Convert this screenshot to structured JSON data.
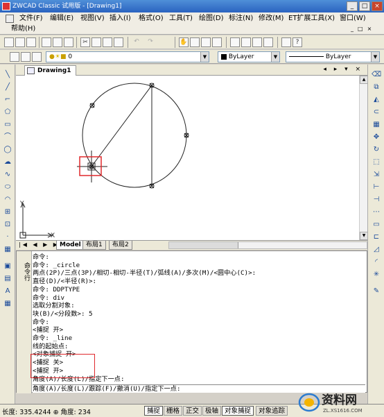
{
  "window": {
    "title": "ZWCAD Classic 试用版 - [Drawing1]",
    "controls": [
      "_",
      "□",
      "×"
    ]
  },
  "menu": {
    "row1": [
      "文件(F)",
      "编辑(E)",
      "视图(V)",
      "插入(I)",
      "格式(O)",
      "工具(T)",
      "绘图(D)",
      "标注(N)",
      "修改(M)",
      "ET扩展工具(X)",
      "窗口(W)"
    ],
    "row2": [
      "帮助(H)"
    ],
    "doc_controls": [
      "_",
      "□",
      "×"
    ]
  },
  "toolbar2": {
    "layer_value": "0",
    "color_value": "ByLayer",
    "linetype_value": "ByLayer"
  },
  "document": {
    "tab_title": "Drawing1",
    "tab_controls": "◂ ▸ ▾ ×"
  },
  "ucs": {
    "x_label": "X",
    "y_label": "Y"
  },
  "layouts": {
    "nav": "|◀ ◀ ▶ ▶|",
    "tabs": [
      "Model",
      "布局1",
      "布局2"
    ]
  },
  "command": {
    "side_label": "命令行",
    "history": [
      "命令:",
      "命令: _circle",
      "两点(2P)/三点(3P)/相切-相切-半径(T)/弧线(A)/多次(M)/<圆中心(C)>:",
      "直径(D)/<半径(R)>:",
      "命令: DDPTYPE",
      "命令: div",
      "选取分割对象:",
      "块(B)/<分段数>: 5",
      "命令:",
      "<捕捉 开>",
      "命令: _line",
      "线的起始点:",
      "<对象捕捉 开>",
      "<捕捉 关>",
      "<捕捉 开>",
      "角度(A)/长度(L)/指定下一点:"
    ],
    "input": "角度(A)/长度(L)/跟踪(F)/撤消(U)/指定下一点:"
  },
  "status": {
    "coords": "长度: 335.4244 ⊕ 角度: 234",
    "buttons": [
      {
        "label": "捕捉",
        "on": true
      },
      {
        "label": "栅格",
        "on": false
      },
      {
        "label": "正交",
        "on": false
      },
      {
        "label": "极轴",
        "on": false
      },
      {
        "label": "对象捕捉",
        "on": true
      },
      {
        "label": "对象追踪",
        "on": false
      }
    ]
  },
  "watermark": {
    "brand": "资料网",
    "site": "ZL.XS1616.COM"
  },
  "colors": {
    "highlight": "#e0282c",
    "title_bar": "#2a63c0"
  }
}
